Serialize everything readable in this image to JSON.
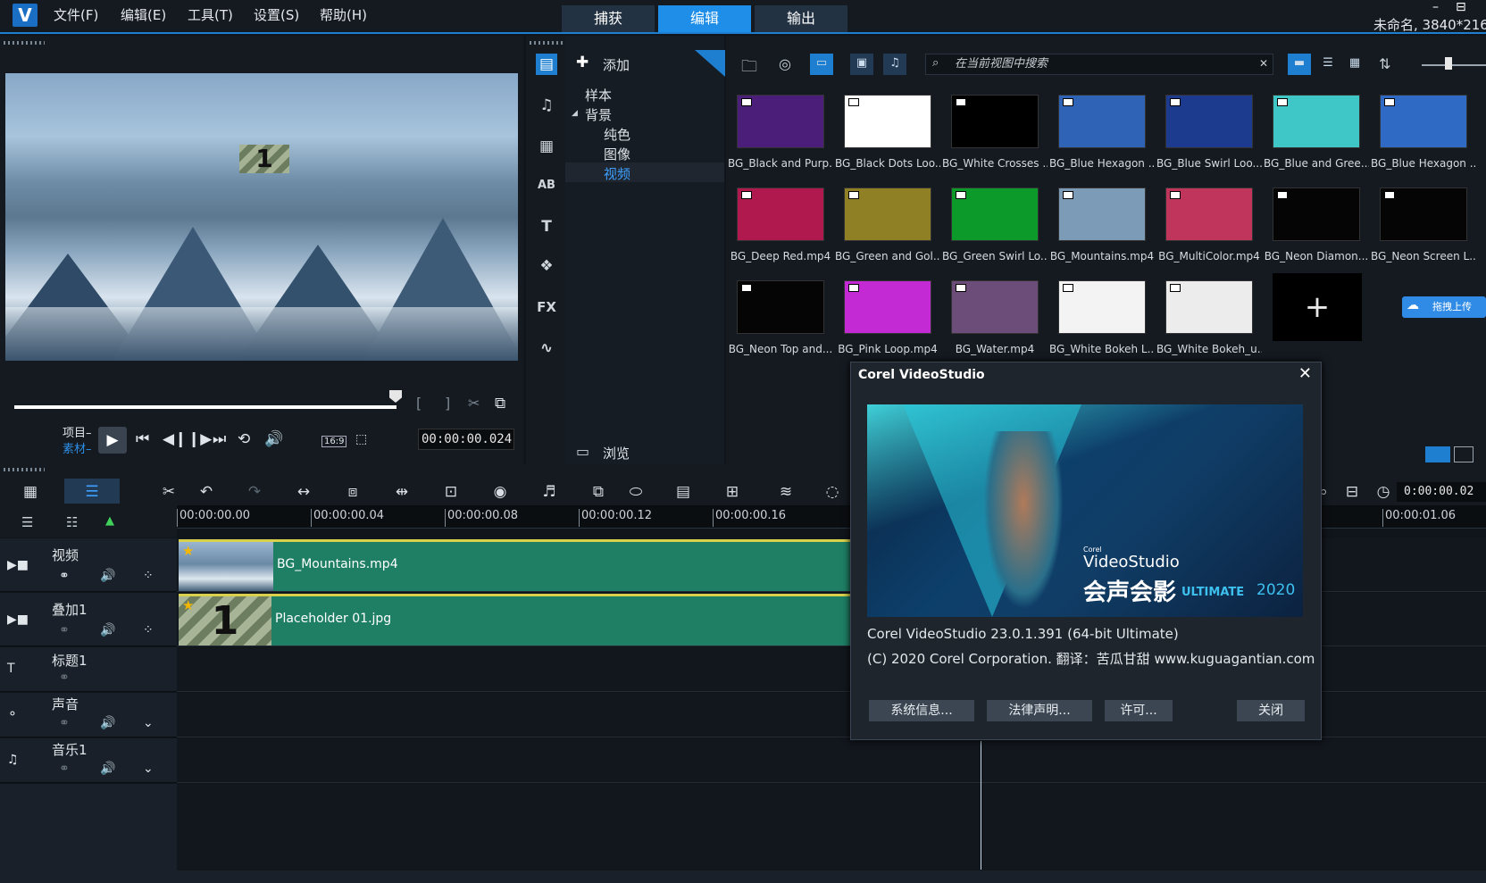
{
  "menu": {
    "file": "文件(F)",
    "edit": "编辑(E)",
    "tools": "工具(T)",
    "settings": "设置(S)",
    "help": "帮助(H)"
  },
  "tabs": {
    "capture": "捕获",
    "edit": "编辑",
    "output": "输出"
  },
  "window": {
    "title": "未命名, 3840*216",
    "minimize": "–",
    "maximize": "⊟"
  },
  "preview": {
    "project_label": "项目–",
    "clip_label": "素材–",
    "timecode": "00:00:00.024",
    "aspect": "16:9",
    "placeholder_num": "1"
  },
  "library": {
    "add_label": "添加",
    "browse_label": "浏览",
    "tree": {
      "samples": "样本",
      "background": "背景",
      "solid": "纯色",
      "image": "图像",
      "video": "视频"
    },
    "search_placeholder": "在当前视图中搜索",
    "upload_label": "拖拽上传",
    "items": [
      {
        "label": "BG_Black and Purp...",
        "color": "#4b1e7a"
      },
      {
        "label": "BG_Black Dots Loo...",
        "color": "#ffffff"
      },
      {
        "label": "BG_White Crosses ...",
        "color": "#000000"
      },
      {
        "label": "BG_Blue Hexagon ...",
        "color": "#2f63b5"
      },
      {
        "label": "BG_Blue Swirl Loo...",
        "color": "#1c3b8f"
      },
      {
        "label": "BG_Blue and Gree...",
        "color": "#3fc6c6"
      },
      {
        "label": "BG_Blue Hexagon ...",
        "color": "#2f6ac4"
      },
      {
        "label": "BG_Deep Red.mp4",
        "color": "#b0194d"
      },
      {
        "label": "BG_Green and Gol...",
        "color": "#8f7f25"
      },
      {
        "label": "BG_Green Swirl Lo...",
        "color": "#0c9a2b"
      },
      {
        "label": "BG_Mountains.mp4",
        "color": "#7c9bb6"
      },
      {
        "label": "BG_MultiColor.mp4",
        "color": "#c0355b"
      },
      {
        "label": "BG_Neon Diamon...",
        "color": "#050505"
      },
      {
        "label": "BG_Neon Screen L...",
        "color": "#050505"
      },
      {
        "label": "BG_Neon Top and...",
        "color": "#050505"
      },
      {
        "label": "BG_Pink Loop.mp4",
        "color": "#c32ad4"
      },
      {
        "label": "BG_Water.mp4",
        "color": "#6c4d7a"
      },
      {
        "label": "BG_White Bokeh L...",
        "color": "#f3f3f3"
      },
      {
        "label": "BG_White Bokeh_u...",
        "color": "#ececec"
      }
    ],
    "add_tile": "+"
  },
  "timeline": {
    "timecode": "0:00:00.02",
    "ruler": [
      "00:00:00.00",
      "00:00:00.04",
      "00:00:00.08",
      "00:00:00.12",
      "00:00:00.16",
      "00:00:01.06"
    ],
    "tracks": {
      "video": "视频",
      "overlay": "叠加1",
      "title": "标题1",
      "voice": "声音",
      "music": "音乐1"
    },
    "clips": {
      "video": "BG_Mountains.mp4",
      "overlay": "Placeholder 01.jpg",
      "overlay_num": "1"
    }
  },
  "dialog": {
    "title": "Corel VideoStudio",
    "close": "✕",
    "art_brand": "Corel",
    "art_product": "VideoStudio",
    "art_cn": "会声会影",
    "art_edition": "ULTIMATE",
    "art_year": "2020",
    "version": "Corel VideoStudio 23.0.1.391  (64-bit Ultimate)",
    "copyright": "(C) 2020 Corel Corporation. 翻译：苦瓜甘甜 www.kuguagantian.com",
    "btn_sysinfo": "系统信息...",
    "btn_legal": "法律声明...",
    "btn_license": "许可...",
    "btn_close": "关闭"
  }
}
